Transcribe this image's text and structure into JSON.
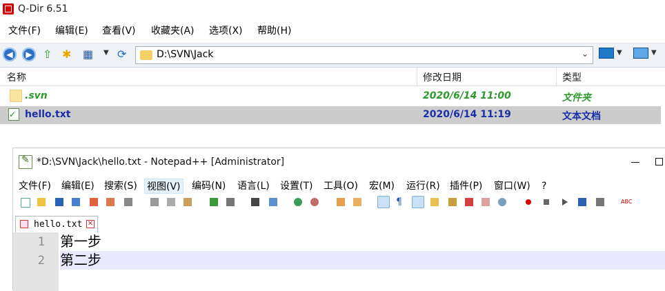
{
  "qdir": {
    "title": "Q-Dir 6.51",
    "menu": [
      "文件(F)",
      "编辑(E)",
      "查看(V)",
      "收藏夹(A)",
      "选项(X)",
      "帮助(H)"
    ],
    "address": "D:\\SVN\\Jack",
    "columns": {
      "name": "名称",
      "date": "修改日期",
      "type": "类型"
    },
    "rows": [
      {
        "name": ".svn",
        "date": "2020/6/14 11:00",
        "type": "文件夹"
      },
      {
        "name": "hello.txt",
        "date": "2020/6/14 11:19",
        "type": "文本文档"
      }
    ],
    "colors": {
      "folder_text": "#2e9a2e",
      "file_text": "#1a2ea8",
      "selection": "#cccccc"
    }
  },
  "notepad": {
    "title": "*D:\\SVN\\Jack\\hello.txt - Notepad++ [Administrator]",
    "menu": [
      "文件(F)",
      "编辑(E)",
      "搜索(S)",
      "视图(V)",
      "编码(N)",
      "语言(L)",
      "设置(T)",
      "工具(O)",
      "宏(M)",
      "运行(R)",
      "插件(P)",
      "窗口(W)",
      "?"
    ],
    "active_menu": "视图(V)",
    "tab": {
      "label": "hello.txt",
      "close_icon": "close-icon"
    },
    "line_numbers": [
      "1",
      "2"
    ],
    "lines": [
      "第一步",
      "第二步"
    ]
  }
}
